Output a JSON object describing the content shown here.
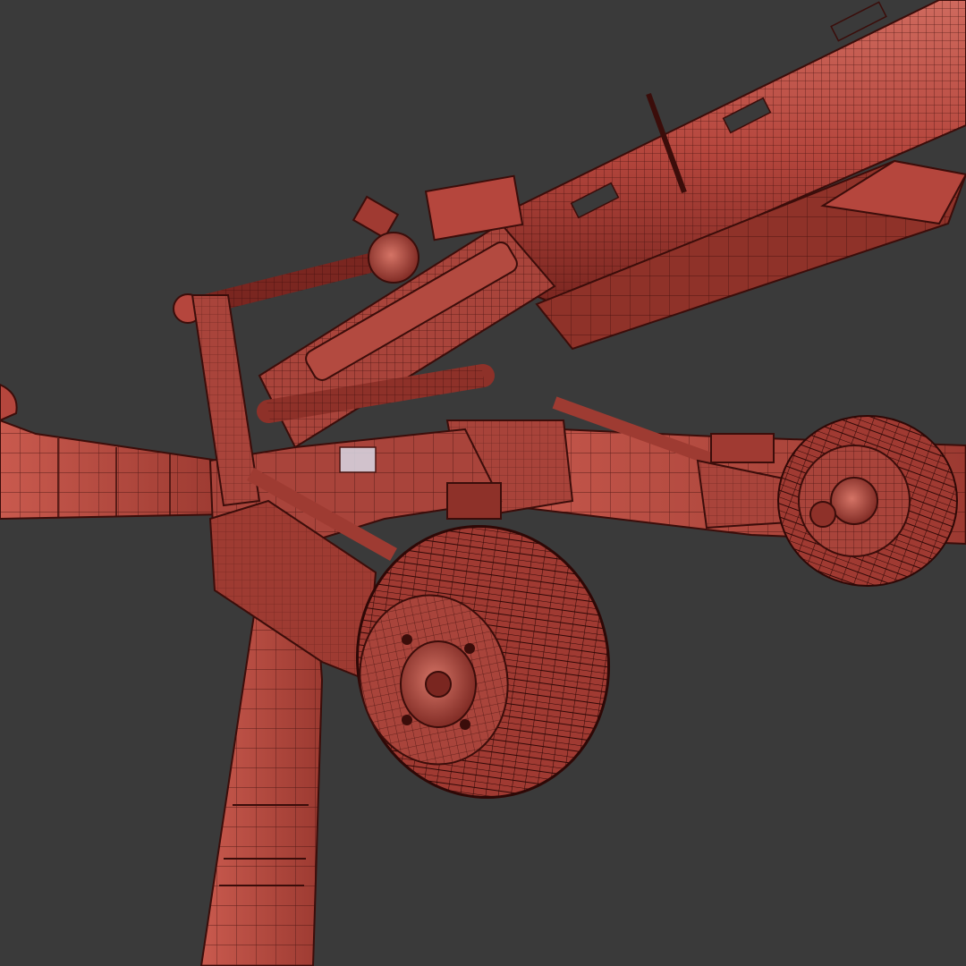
{
  "viewport": {
    "background_color": "#3a3a3a",
    "subject": "towed-howitzer-wireframe-model"
  },
  "colors": {
    "mesh_fill": "#b5463d",
    "mesh_fill_light": "#cf6a5e",
    "mesh_fill_dark": "#7a2620",
    "wire_color": "#3b0d0a",
    "shadow": "#5a1a15"
  },
  "parts": [
    {
      "name": "barrel-assembly"
    },
    {
      "name": "recoil-cylinders"
    },
    {
      "name": "equilibrator"
    },
    {
      "name": "left-trail-leg"
    },
    {
      "name": "front-trail-leg"
    },
    {
      "name": "right-trail-leg"
    },
    {
      "name": "front-wheel"
    },
    {
      "name": "rear-wheel"
    },
    {
      "name": "suspension-arms"
    }
  ]
}
